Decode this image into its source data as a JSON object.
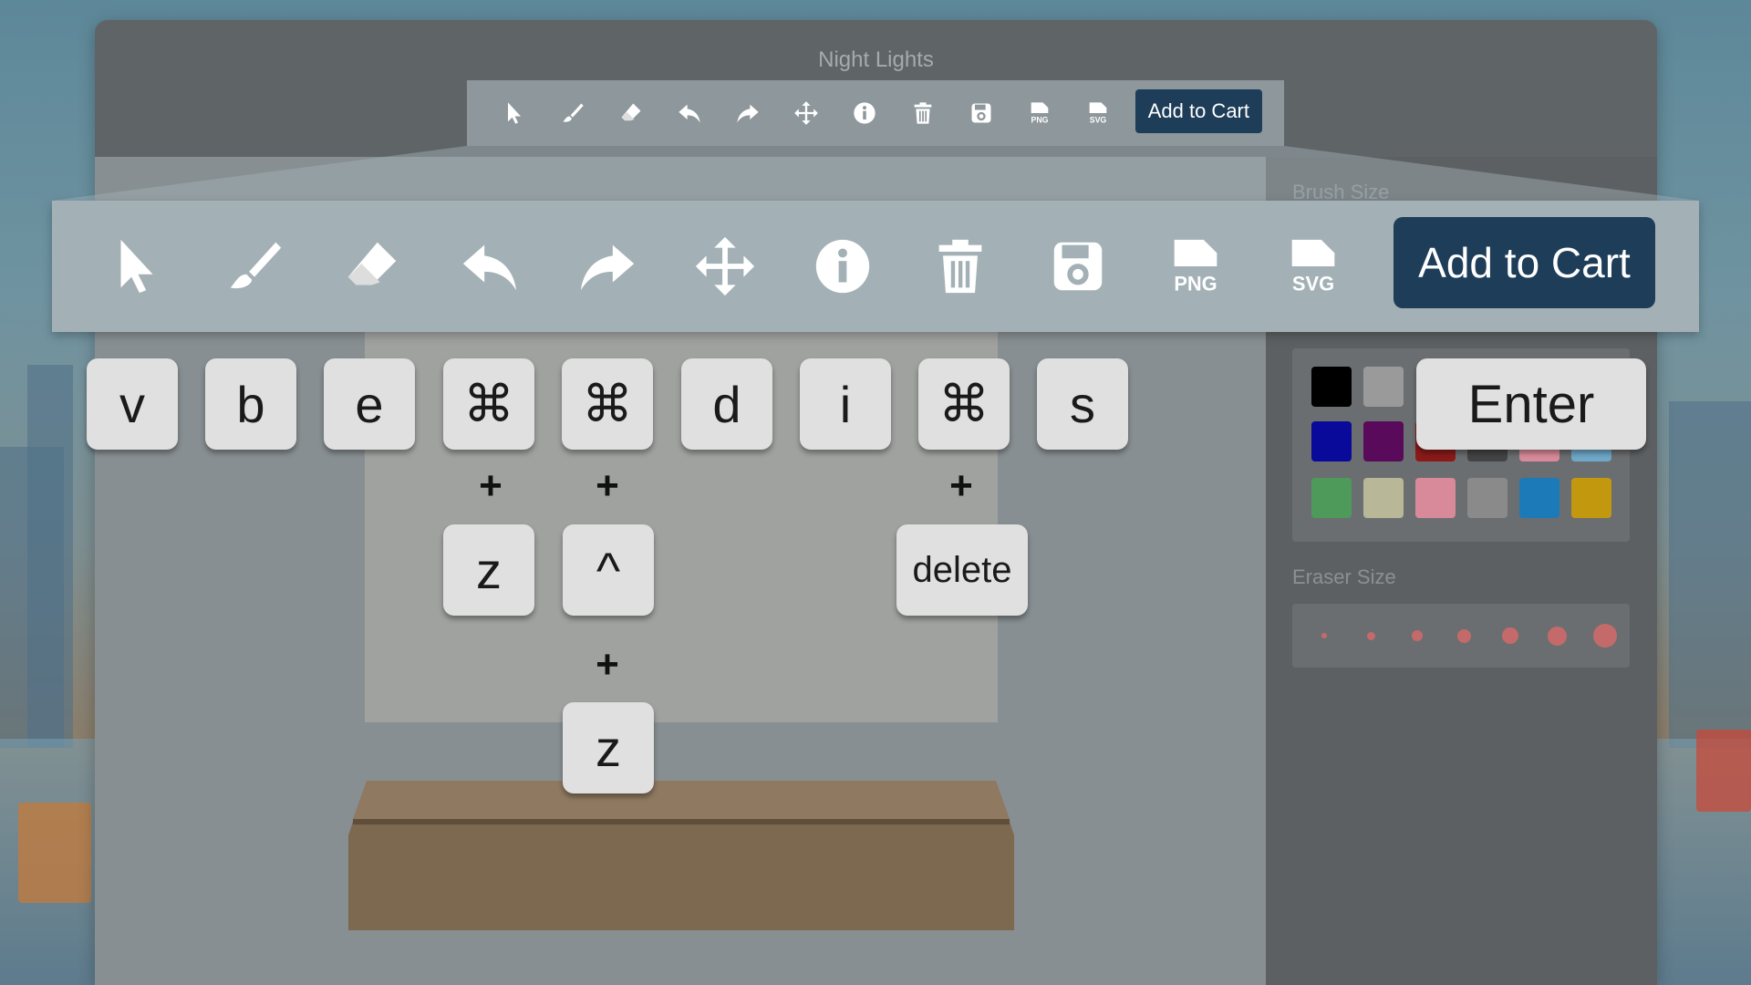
{
  "app": {
    "title": "Night Lights"
  },
  "toolbar": {
    "tools": [
      {
        "name": "select-arrow-icon"
      },
      {
        "name": "brush-icon"
      },
      {
        "name": "eraser-icon"
      },
      {
        "name": "undo-icon"
      },
      {
        "name": "redo-icon"
      },
      {
        "name": "move-icon"
      },
      {
        "name": "info-icon"
      },
      {
        "name": "trash-icon"
      },
      {
        "name": "save-icon"
      },
      {
        "name": "png-export-icon",
        "badge": "PNG"
      },
      {
        "name": "svg-export-icon",
        "badge": "SVG"
      }
    ],
    "add_to_cart": "Add to Cart"
  },
  "panel": {
    "brush_size_label": "Brush Size",
    "eraser_size_label": "Eraser Size",
    "swatch_colors": [
      "#000000",
      "#9a9a9a",
      "#0a0a9a",
      "#5a0a5a",
      "#8a1a1a",
      "#444444",
      "#d98a9a",
      "#6fa8c8",
      "#4e9a5a",
      "#b8b898",
      "#d88a9a",
      "#8a8a8a",
      "#1c7ab8",
      "#c2980f"
    ]
  },
  "shortcuts": {
    "select": "v",
    "brush": "b",
    "eraser": "e",
    "undo_mod": "⌘",
    "undo_key": "z",
    "redo_mod": "⌘",
    "redo_key2": "^",
    "redo_key3": "z",
    "move": "d",
    "info": "i",
    "delete_mod": "⌘",
    "delete_key": "delete",
    "save": "s",
    "cart": "Enter",
    "plus": "+"
  }
}
